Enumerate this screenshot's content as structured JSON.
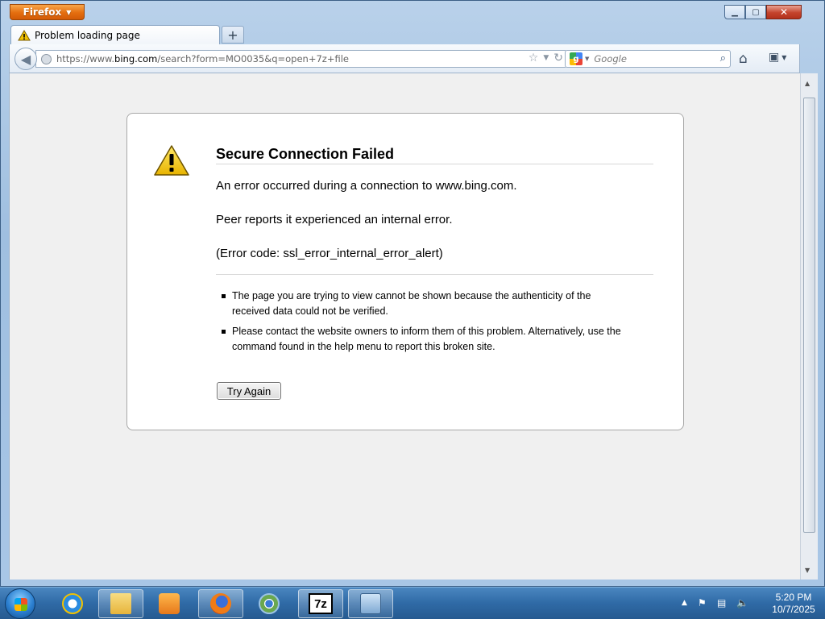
{
  "window": {
    "app_button": "Firefox",
    "controls": {
      "minimize": "▁",
      "maximize": "▢",
      "close": "✕"
    }
  },
  "tabs": [
    {
      "label": "Problem loading page",
      "icon": "warning-icon"
    }
  ],
  "new_tab_label": "+",
  "nav": {
    "url_prefix": "https://www.",
    "url_domain": "bing.com",
    "url_rest": "/search?form=MO0035&q=open+7z+file",
    "search_placeholder": "Google",
    "search_engine_letter": "g"
  },
  "error": {
    "title": "Secure Connection Failed",
    "line1": "An error occurred during a connection to www.bing.com.",
    "line2": "Peer reports it experienced an internal error.",
    "line3": "(Error code: ssl_error_internal_error_alert)",
    "bullets": [
      "The page you are trying to view cannot be shown because the authenticity of the received data could not be verified.",
      "Please contact the website owners to inform them of this problem. Alternatively, use the command found in the help menu to report this broken site."
    ],
    "try_again_label": "Try Again"
  },
  "taskbar": {
    "items": [
      {
        "name": "internet-explorer-icon",
        "state": "pinned"
      },
      {
        "name": "file-explorer-icon",
        "state": "running"
      },
      {
        "name": "media-player-icon",
        "state": "pinned"
      },
      {
        "name": "firefox-icon",
        "state": "running"
      },
      {
        "name": "chrome-icon",
        "state": "pinned"
      },
      {
        "name": "7zip-icon",
        "state": "running",
        "label": "7z"
      },
      {
        "name": "network-app-icon",
        "state": "running"
      }
    ],
    "clock_time": "5:20 PM",
    "clock_date": "10/7/2025"
  },
  "colors": {
    "firefox_orange": "#e46e0f",
    "warning_yellow": "#f2c200",
    "taskbar_blue": "#2f6aa6"
  }
}
